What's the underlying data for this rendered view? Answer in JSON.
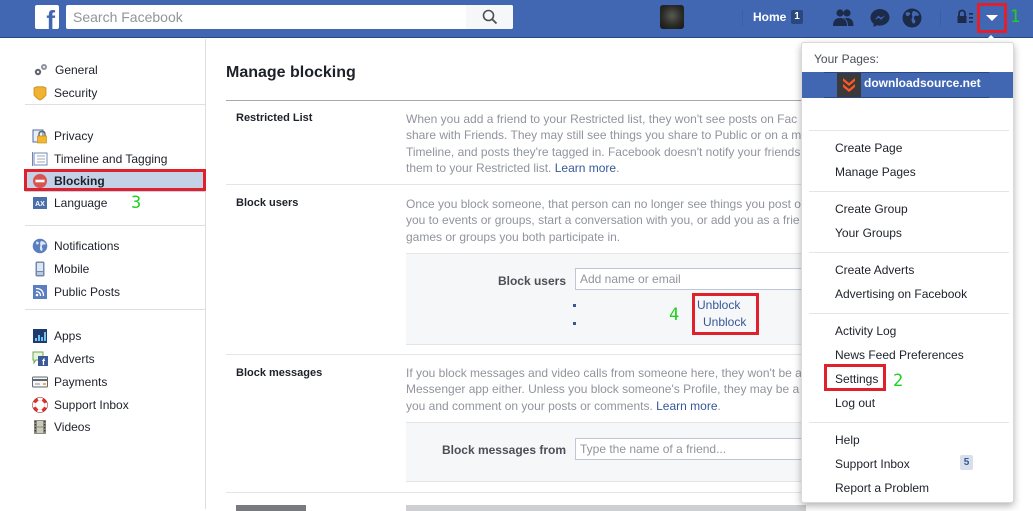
{
  "topbar": {
    "logo": "f",
    "search_placeholder": "Search Facebook",
    "home_label": "Home",
    "home_badge": "1",
    "icons": [
      "facebook-logo",
      "search-icon",
      "profile-avatar",
      "friend-requests-icon",
      "messenger-icon",
      "notifications-globe-icon",
      "privacy-shortcuts-icon",
      "account-menu-caret-icon"
    ]
  },
  "annotations": {
    "step1": "1",
    "step2": "2",
    "step3": "3",
    "step4": "4",
    "highlight_color": "#e0202a",
    "number_color": "#1ed11e"
  },
  "sidebar": {
    "groups": [
      {
        "items": [
          {
            "label": "General",
            "icon": "gears-icon"
          },
          {
            "label": "Security",
            "icon": "shield-icon"
          }
        ]
      },
      {
        "items": [
          {
            "label": "Privacy",
            "icon": "lock-icon"
          },
          {
            "label": "Timeline and Tagging",
            "icon": "timeline-icon"
          },
          {
            "label": "Blocking",
            "icon": "block-icon",
            "active": true
          },
          {
            "label": "Language",
            "icon": "language-icon"
          }
        ]
      },
      {
        "items": [
          {
            "label": "Notifications",
            "icon": "globe-icon"
          },
          {
            "label": "Mobile",
            "icon": "mobile-icon"
          },
          {
            "label": "Public Posts",
            "icon": "rss-icon"
          }
        ]
      },
      {
        "items": [
          {
            "label": "Apps",
            "icon": "apps-icon"
          },
          {
            "label": "Adverts",
            "icon": "adverts-icon"
          },
          {
            "label": "Payments",
            "icon": "credit-card-icon"
          },
          {
            "label": "Support Inbox",
            "icon": "lifebuoy-icon"
          },
          {
            "label": "Videos",
            "icon": "film-icon"
          }
        ]
      }
    ]
  },
  "main": {
    "title": "Manage blocking",
    "sections": {
      "restricted": {
        "label": "Restricted List",
        "lines": [
          "When you add a friend to your Restricted list, they won't see posts on Fac",
          "share with Friends. They may still see things you share to Public or on a m",
          "Timeline, and posts they're tagged in. Facebook doesn't notify your friends",
          "them to your Restricted list. "
        ],
        "learn_more": "Learn more",
        "tail": "."
      },
      "block_users": {
        "label": "Block users",
        "lines": [
          "Once you block someone, that person can no longer see things you post o",
          "you to events or groups, start a conversation with you, or add you as a frie",
          "games or groups you both participate in."
        ],
        "form_label": "Block users",
        "input_placeholder": "Add name or email",
        "unblock_links": [
          "Unblock",
          "Unblock"
        ]
      },
      "block_messages": {
        "label": "Block messages",
        "lines": [
          "If you block messages and video calls from someone here, they won't be a",
          "Messenger app either. Unless you block someone's Profile, they may be a",
          "you and comment on your posts or comments. "
        ],
        "learn_more": "Learn more",
        "tail": ".",
        "form_label": "Block messages from",
        "input_placeholder": "Type the name of a friend..."
      }
    }
  },
  "dropdown": {
    "header": "Your Pages:",
    "page_name": "downloadsource.net",
    "groups": [
      [
        "Create Page",
        "Manage Pages"
      ],
      [
        "Create Group",
        "Your Groups"
      ],
      [
        "Create Adverts",
        "Advertising on Facebook"
      ],
      [
        "Activity Log",
        "News Feed Preferences",
        "Settings",
        "Log out"
      ],
      [
        "Help",
        "Support Inbox",
        "Report a Problem"
      ]
    ],
    "support_inbox_badge": "5"
  }
}
